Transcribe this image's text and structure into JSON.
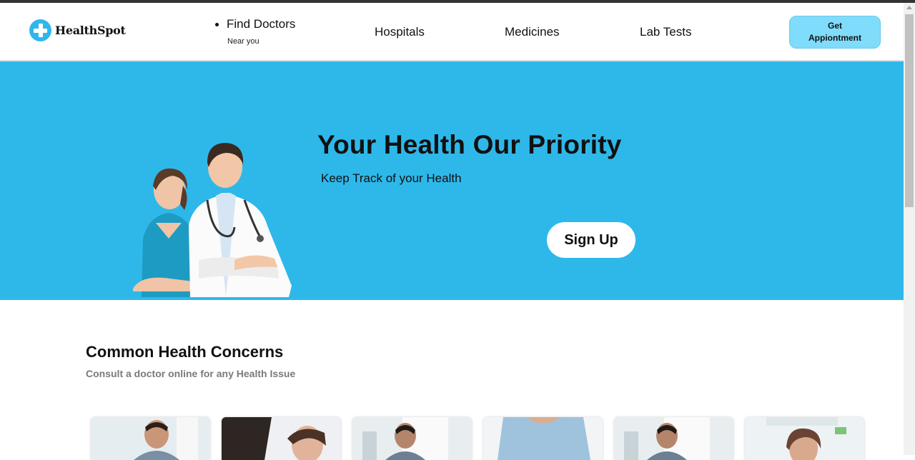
{
  "logo": {
    "name": "HealthSpot"
  },
  "nav": {
    "find_doctors": {
      "label": "Find Doctors",
      "sublabel": "Near you"
    },
    "hospitals": "Hospitals",
    "medicines": "Medicines",
    "lab_tests": "Lab Tests",
    "appointment_button": "Get Appiontment"
  },
  "hero": {
    "title": "Your Health Our Priority",
    "subtitle": "Keep Track of your Health",
    "signup_button": "Sign Up"
  },
  "concerns": {
    "title": "Common Health Concerns",
    "subtitle": "Consult a doctor online for any Health Issue"
  },
  "colors": {
    "hero_bg": "#2eb8ea",
    "button_bg": "#7fdcfb"
  }
}
